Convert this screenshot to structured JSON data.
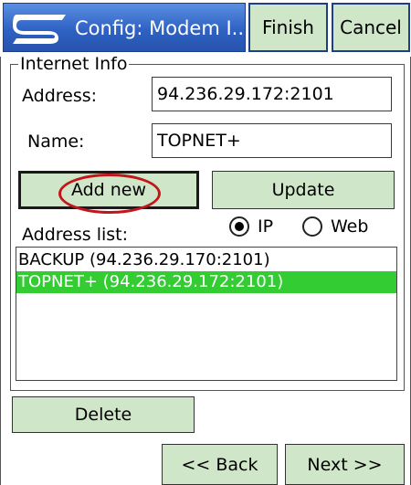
{
  "titlebar": {
    "title": "Config: Modem I...",
    "finish_label": "Finish",
    "cancel_label": "Cancel"
  },
  "group": {
    "legend": "Internet Info",
    "address_label": "Address:",
    "address_value": "94.236.29.172:2101",
    "name_label": "Name:",
    "name_value": "TOPNET+",
    "add_new_label": "Add new",
    "update_label": "Update",
    "address_list_label": "Address list:",
    "radio": {
      "ip_label": "IP",
      "web_label": "Web",
      "selected": "IP"
    },
    "address_list": [
      {
        "text": "BACKUP (94.236.29.170:2101)",
        "selected": false
      },
      {
        "text": "TOPNET+ (94.236.29.172:2101)",
        "selected": true
      }
    ]
  },
  "footer": {
    "delete_label": "Delete",
    "back_label": "<< Back",
    "next_label": "Next >>"
  },
  "colors": {
    "title_bar": "#2f62c4",
    "button_bg": "#cfe7c8",
    "selection": "#33cc33",
    "highlight_ellipse": "#c2161c"
  },
  "icons": {
    "app_logo": "topcon-logo-icon"
  }
}
